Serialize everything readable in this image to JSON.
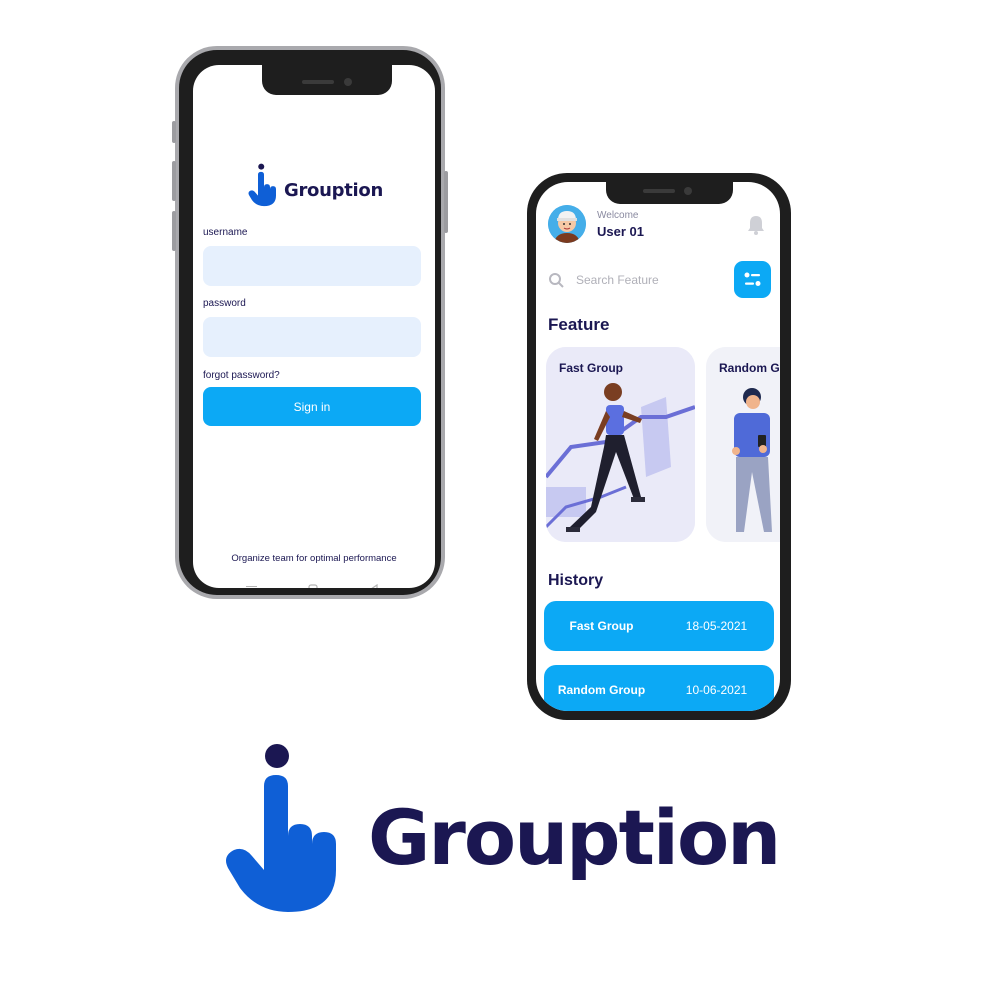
{
  "colors": {
    "primary": "#0ca9f5",
    "brand_blue": "#0f5fd6",
    "navy": "#1b1752",
    "field_bg": "#e6f0fd"
  },
  "login_screen": {
    "brand": "Grouption",
    "username_label": "username",
    "password_label": "password",
    "forgot_password": "forgot password?",
    "signin_label": "Sign in",
    "tagline": "Organize team for optimal performance",
    "nav_icons": [
      "menu-icon",
      "home-square-icon",
      "back-triangle-icon"
    ]
  },
  "dashboard": {
    "welcome": "Welcome",
    "user": "User 01",
    "search_placeholder": "Search Feature",
    "feature_title": "Feature",
    "features": [
      {
        "label": "Fast Group"
      },
      {
        "label": "Random Group"
      }
    ],
    "history_title": "History",
    "history": [
      {
        "name": "Fast Group",
        "date": "18-05-2021"
      },
      {
        "name": "Random Group",
        "date": "10-06-2021"
      }
    ]
  },
  "logo": {
    "brand": "Grouption"
  }
}
